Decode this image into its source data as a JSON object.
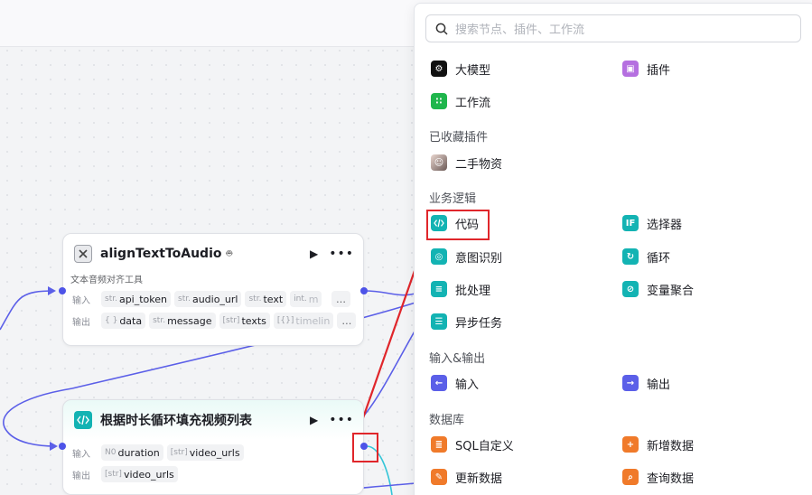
{
  "colors": {
    "accent": "#4d53e8",
    "annotation": "#e0262b",
    "logic_teal": "#13b3b3",
    "plugin_purple": "#b56fe0",
    "workflow_green": "#1fb64c",
    "io_indigo": "#5b5fe8",
    "db_orange": "#f07a2a"
  },
  "nodes": {
    "align": {
      "title": "alignTextToAudio",
      "icon": "close-box-icon",
      "description": "文本音频对齐工具",
      "input_label": "输入",
      "output_label": "输出",
      "inputs": [
        {
          "type": "str.",
          "name": "api_token"
        },
        {
          "type": "str.",
          "name": "audio_url"
        },
        {
          "type": "str.",
          "name": "text"
        },
        {
          "type": "int.",
          "name": "m"
        }
      ],
      "outputs": [
        {
          "type": "{ }",
          "name": "data"
        },
        {
          "type": "str.",
          "name": "message"
        },
        {
          "type": "[str]",
          "name": "texts"
        },
        {
          "type": "[{}]",
          "name": "timelin"
        }
      ]
    },
    "loop": {
      "title": "根据时长循环填充视频列表",
      "icon": "code-icon",
      "input_label": "输入",
      "output_label": "输出",
      "inputs": [
        {
          "type": "N0",
          "name": "duration"
        },
        {
          "type": "[str]",
          "name": "video_urls"
        }
      ],
      "outputs": [
        {
          "type": "[str]",
          "name": "video_urls"
        }
      ]
    }
  },
  "panel": {
    "search_placeholder": "搜索节点、插件、工作流",
    "top_items": [
      {
        "label": "大模型",
        "icon": "llm-icon"
      },
      {
        "label": "插件",
        "icon": "plugin-cube-icon"
      },
      {
        "label": "工作流",
        "icon": "workflow-icon"
      }
    ],
    "sections": [
      {
        "title": "已收藏插件",
        "items": [
          {
            "label": "二手物资",
            "icon": "avatar-icon"
          }
        ]
      },
      {
        "title": "业务逻辑",
        "items": [
          {
            "label": "代码",
            "icon": "code-icon"
          },
          {
            "label": "选择器",
            "icon": "if-icon"
          },
          {
            "label": "意图识别",
            "icon": "bulb-icon"
          },
          {
            "label": "循环",
            "icon": "loop-icon"
          },
          {
            "label": "批处理",
            "icon": "layers-icon"
          },
          {
            "label": "变量聚合",
            "icon": "merge-icon"
          },
          {
            "label": "异步任务",
            "icon": "async-task-icon"
          }
        ]
      },
      {
        "title": "输入&输出",
        "items": [
          {
            "label": "输入",
            "icon": "input-icon"
          },
          {
            "label": "输出",
            "icon": "output-icon"
          }
        ]
      },
      {
        "title": "数据库",
        "items": [
          {
            "label": "SQL自定义",
            "icon": "db-sql-icon"
          },
          {
            "label": "新增数据",
            "icon": "db-add-icon"
          },
          {
            "label": "更新数据",
            "icon": "db-update-icon"
          },
          {
            "label": "查询数据",
            "icon": "db-query-icon"
          }
        ]
      }
    ]
  }
}
